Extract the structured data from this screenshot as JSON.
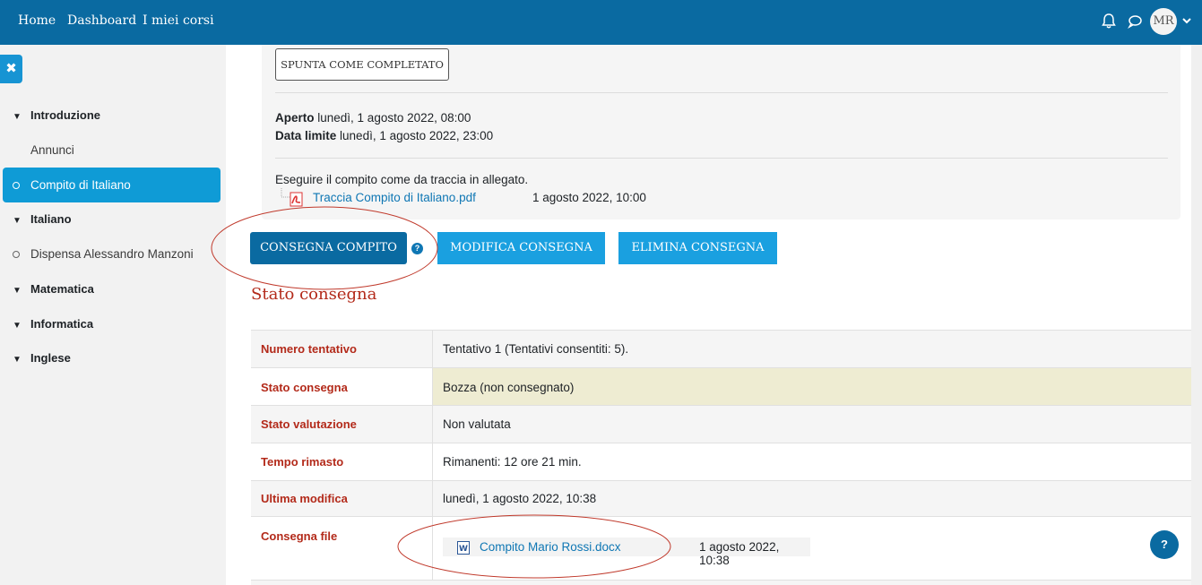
{
  "navbar": {
    "links": [
      "Home",
      "Dashboard",
      "I miei corsi"
    ],
    "bell_icon": "bell-icon",
    "chat_icon": "chat-bubble-icon",
    "avatar_initials": "MR",
    "dropdown_icon": "chevron-down-icon",
    "color": "#0a6aa1"
  },
  "drawer": {
    "close_icon": "close-icon",
    "sections": [
      {
        "label": "Introduzione"
      },
      {
        "label": "Italiano"
      },
      {
        "label": "Matematica"
      },
      {
        "label": "Informatica"
      },
      {
        "label": "Inglese"
      }
    ],
    "items": [
      {
        "label": "Annunci"
      },
      {
        "label": "Compito di Italiano",
        "active": true
      },
      {
        "label": "Dispensa Alessandro Manzoni"
      }
    ]
  },
  "activity": {
    "mark_complete_label": "SPUNTA COME COMPLETATO",
    "opened_label": "Aperto",
    "opened_value": "lunedì, 1 agosto 2022, 08:00",
    "due_label": "Data limite",
    "due_value": "lunedì, 1 agosto 2022, 23:00",
    "description": "Eseguire il compito come da traccia in allegato.",
    "attachment": {
      "name": "Traccia Compito di Italiano.pdf",
      "date": "1 agosto 2022, 10:00",
      "icon": "pdf-file-icon"
    }
  },
  "actions": {
    "submit_label": "CONSEGNA COMPITO",
    "help_icon": "question-circle-icon",
    "edit_label": "MODIFICA CONSEGNA",
    "delete_label": "ELIMINA CONSEGNA"
  },
  "status": {
    "heading": "Stato consegna",
    "rows": [
      {
        "label": "Numero tentativo",
        "value": "Tentativo 1 (Tentativi consentiti: 5)."
      },
      {
        "label": "Stato consegna",
        "value": "Bozza (non consegnato)"
      },
      {
        "label": "Stato valutazione",
        "value": "Non valutata"
      },
      {
        "label": "Tempo rimasto",
        "value": "Rimanenti: 12 ore 21 min."
      },
      {
        "label": "Ultima modifica",
        "value": "lunedì, 1 agosto 2022, 10:38"
      },
      {
        "label": "Consegna file",
        "value": ""
      }
    ],
    "file": {
      "name": "Compito Mario Rossi.docx",
      "date": "1 agosto 2022, 10:38",
      "icon": "word-file-icon"
    }
  },
  "page_help_icon": "question-circle-icon",
  "colors": {
    "accent": "#0f9bd6",
    "heading_red": "#b32a1a",
    "annotation_red": "#c0392b",
    "draft_yellow": "#eeecd2"
  }
}
